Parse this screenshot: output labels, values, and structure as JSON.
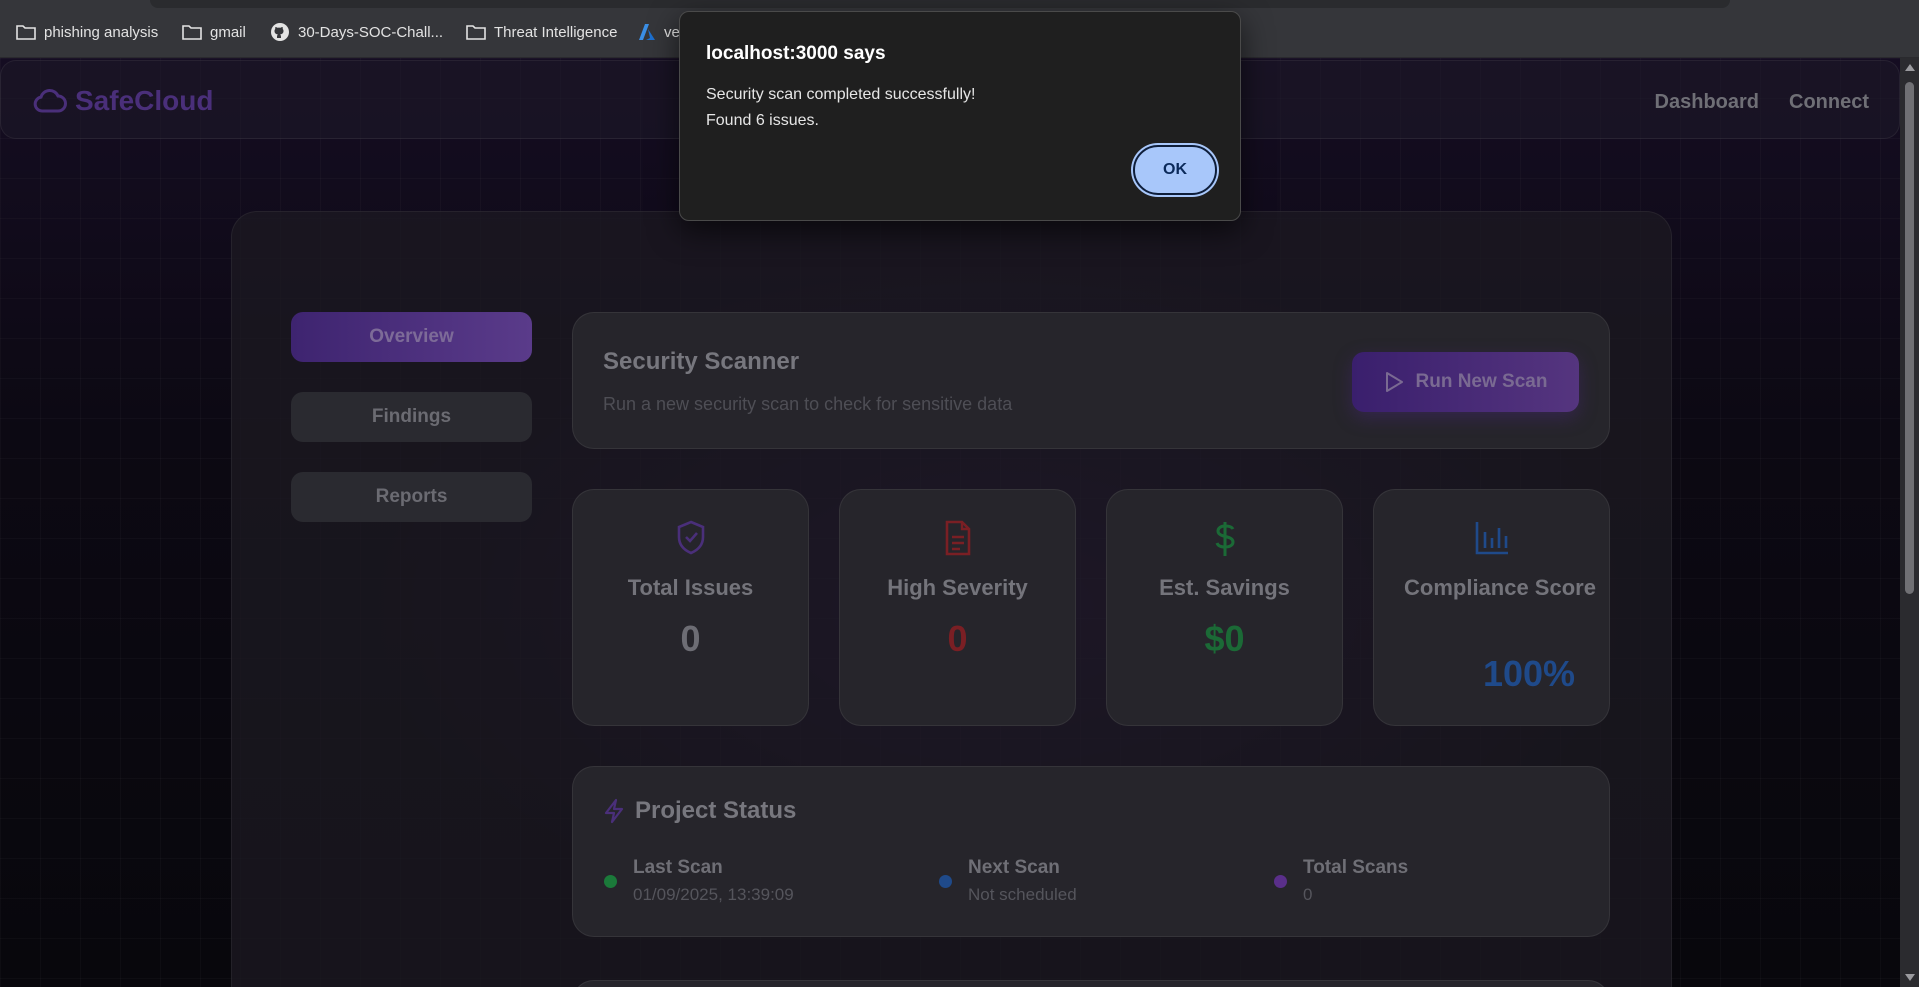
{
  "bookmarks": [
    {
      "label": "phishing analysis",
      "icon": "folder-icon"
    },
    {
      "label": "gmail",
      "icon": "folder-icon"
    },
    {
      "label": "30-Days-SOC-Chall...",
      "icon": "github-icon"
    },
    {
      "label": "Threat Intelligence",
      "icon": "folder-icon"
    },
    {
      "label": "ve",
      "icon": "azure-icon"
    }
  ],
  "navbar": {
    "brand": "SafeCloud",
    "links": [
      "Dashboard",
      "Connect"
    ]
  },
  "sidebar": {
    "items": [
      {
        "label": "Overview",
        "active": true
      },
      {
        "label": "Findings",
        "active": false
      },
      {
        "label": "Reports",
        "active": false
      }
    ]
  },
  "scanner": {
    "title": "Security Scanner",
    "subtitle": "Run a new security scan to check for sensitive data",
    "button_label": "Run New Scan"
  },
  "stats": [
    {
      "label": "Total Issues",
      "value": "0",
      "icon": "shield-check-icon",
      "color": "#6d6d74"
    },
    {
      "label": "High Severity",
      "value": "0",
      "icon": "document-icon",
      "color": "#7a1f24"
    },
    {
      "label": "Est. Savings",
      "value": "$0",
      "icon": "dollar-icon",
      "color": "#1b6a36"
    },
    {
      "label": "Compliance Score",
      "value": "100%",
      "icon": "bar-chart-icon",
      "color": "#1f4a8a"
    }
  ],
  "project_status": {
    "title": "Project Status",
    "items": [
      {
        "label": "Last Scan",
        "value": "01/09/2025, 13:39:09",
        "color": "#1b7a3a"
      },
      {
        "label": "Next Scan",
        "value": "Not scheduled",
        "color": "#1f4a8a"
      },
      {
        "label": "Total Scans",
        "value": "0",
        "color": "#5a2f8a"
      }
    ]
  },
  "dialog": {
    "title": "localhost:3000 says",
    "line1": "Security scan completed successfully!",
    "line2": "Found 6 issues.",
    "ok_label": "OK"
  }
}
